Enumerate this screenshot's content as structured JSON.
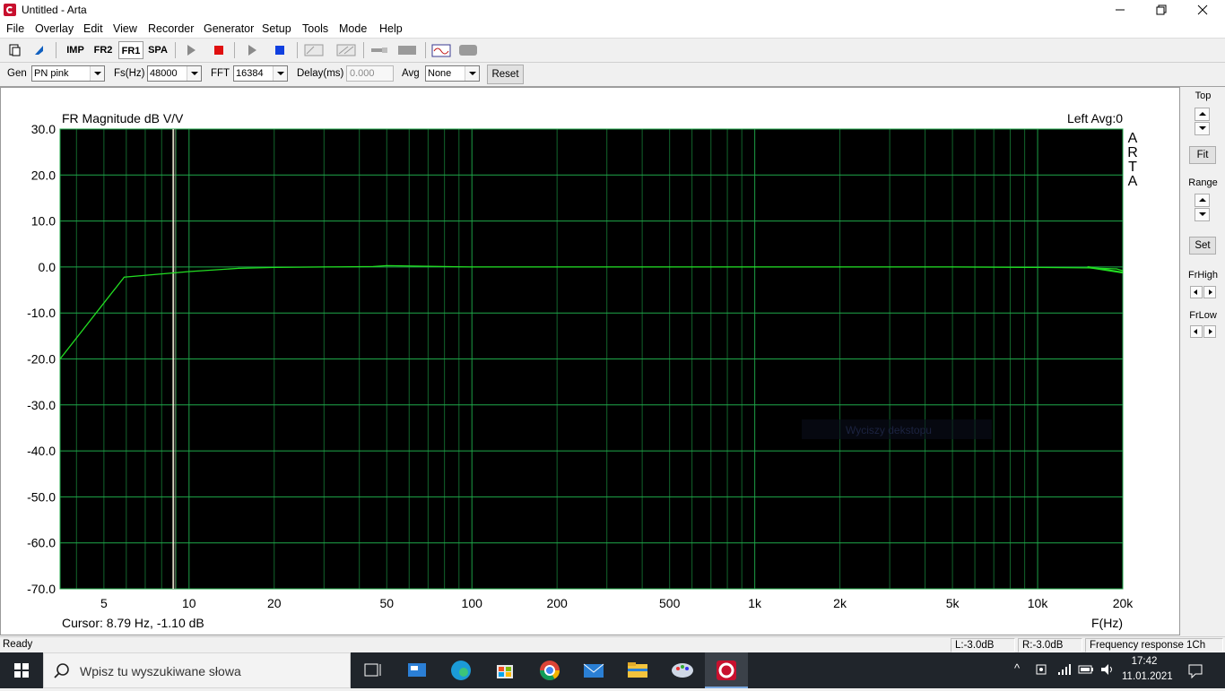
{
  "window": {
    "title": "Untitled - Arta"
  },
  "menu": [
    "File",
    "Overlay",
    "Edit",
    "View",
    "Recorder",
    "Generator",
    "Setup",
    "Tools",
    "Mode",
    "Help"
  ],
  "toolbar": {
    "imp": "IMP",
    "fr2": "FR2",
    "fr1": "FR1",
    "spa": "SPA"
  },
  "settings": {
    "gen_label": "Gen",
    "gen_value": "PN pink",
    "fs_label": "Fs(Hz)",
    "fs_value": "48000",
    "fft_label": "FFT",
    "fft_value": "16384",
    "delay_label": "Delay(ms)",
    "delay_value": "0.000",
    "avg_label": "Avg",
    "avg_value": "None",
    "reset_label": "Reset"
  },
  "graph": {
    "title": "FR Magnitude dB V/V",
    "channel_info": "Left  Avg:0",
    "brand": [
      "A",
      "R",
      "T",
      "A"
    ],
    "cursor_text": "Cursor: 8.79 Hz, -1.10 dB",
    "cursor_freq_hz": 8.79,
    "xunit": "F(Hz)",
    "watermark": "Wyciszy dekstopu"
  },
  "chart_data": {
    "type": "line",
    "title": "FR Magnitude dB V/V",
    "xlabel": "F(Hz)",
    "ylabel": "",
    "xscale": "log",
    "xlim": [
      3.5,
      20000
    ],
    "ylim": [
      -70,
      30
    ],
    "grid": true,
    "yticks": [
      30,
      20,
      10,
      0,
      -10,
      -20,
      -30,
      -40,
      -50,
      -60,
      -70
    ],
    "ytick_labels": [
      "30.0",
      "20.0",
      "10.0",
      "0.0",
      "-10.0",
      "-20.0",
      "-30.0",
      "-40.0",
      "-50.0",
      "-60.0",
      "-70.0"
    ],
    "xticks": [
      5,
      10,
      20,
      50,
      100,
      200,
      500,
      1000,
      2000,
      5000,
      10000,
      20000
    ],
    "xtick_labels": [
      "5",
      "10",
      "20",
      "50",
      "100",
      "200",
      "500",
      "1k",
      "2k",
      "5k",
      "10k",
      "20k"
    ],
    "series": [
      {
        "name": "Left",
        "color": "#22dd22",
        "x": [
          3.5,
          5.9,
          10,
          15,
          20,
          30,
          45,
          50,
          100,
          200,
          500,
          1000,
          2000,
          5000,
          10000,
          15000,
          19000,
          20000
        ],
        "y": [
          -20,
          -2.2,
          -1.0,
          -0.3,
          -0.1,
          0.0,
          0.1,
          0.3,
          0.0,
          0.0,
          0.0,
          0.0,
          0.0,
          0.0,
          -0.1,
          -0.2,
          -0.4,
          -0.8
        ]
      }
    ],
    "grid_color": "#1fa84a",
    "background": "#000000"
  },
  "right_panel": {
    "top": "Top",
    "fit": "Fit",
    "range": "Range",
    "set": "Set",
    "frhigh": "FrHigh",
    "frlow": "FrLow"
  },
  "status": {
    "ready": "Ready",
    "l_level": "L:-3.0dB",
    "r_level": "R:-3.0dB",
    "mode": "Frequency response 1Ch"
  },
  "taskbar": {
    "search_placeholder": "Wpisz tu wyszukiwane słowa",
    "time": "17:42",
    "date": "11.01.2021",
    "apps": [
      "task-view-icon",
      "monitor-app-icon",
      "edge-icon",
      "store-icon",
      "chrome-icon",
      "mail-icon",
      "file-explorer-icon",
      "paint-icon",
      "arta-icon"
    ]
  }
}
